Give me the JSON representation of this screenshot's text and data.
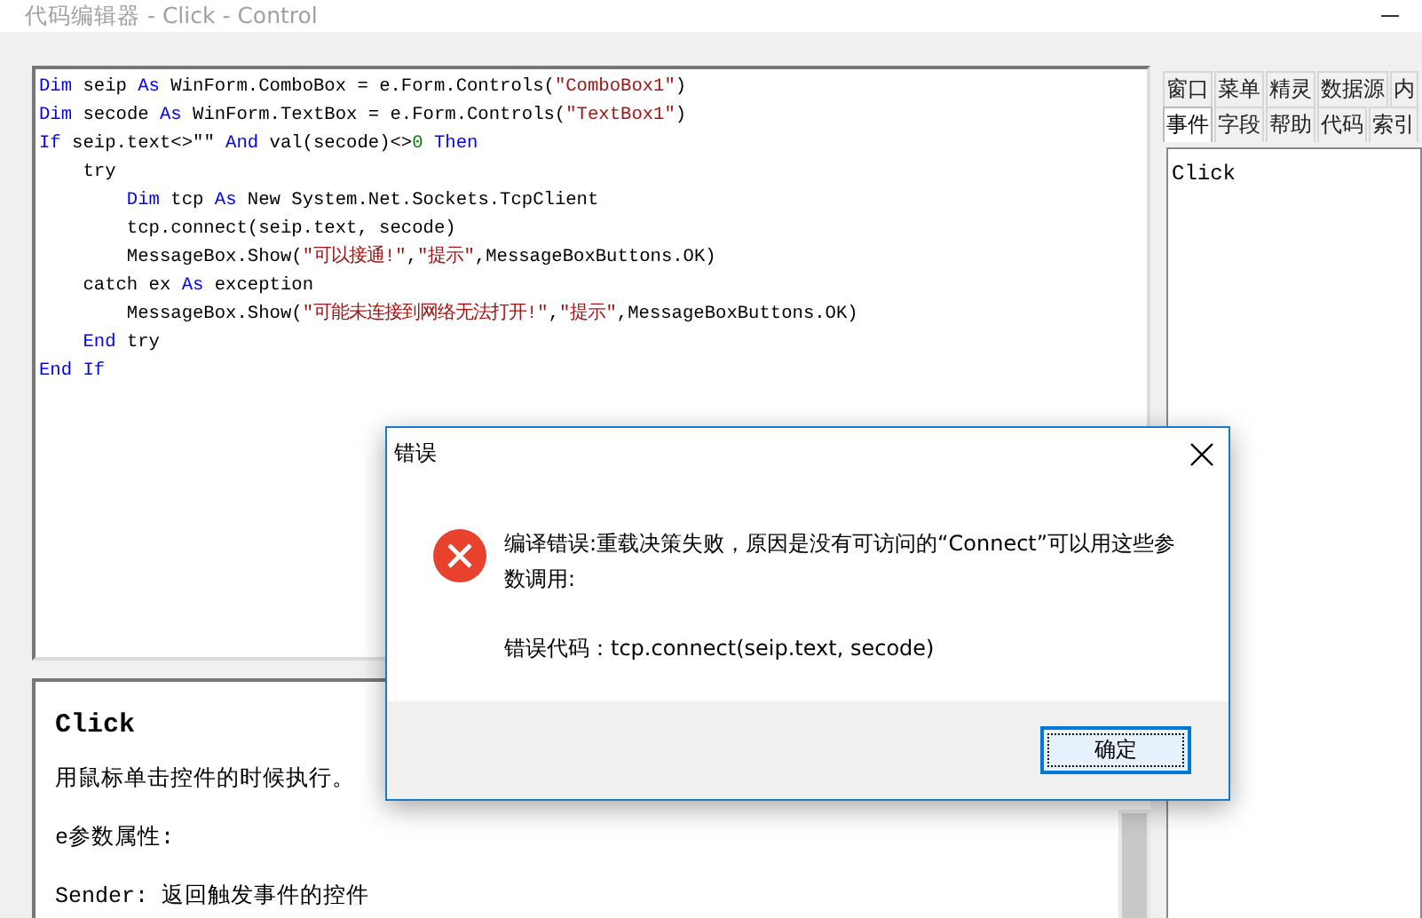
{
  "window": {
    "title": "代码编辑器 - Click - Control"
  },
  "code_editor": {
    "lines": [
      {
        "tokens": [
          {
            "text": "Dim",
            "kind": "keyword"
          },
          {
            "text": " seip ",
            "kind": "plain"
          },
          {
            "text": "As",
            "kind": "keyword"
          },
          {
            "text": " WinForm.ComboBox = e.Form.Controls(",
            "kind": "plain"
          },
          {
            "text": "\"ComboBox1\"",
            "kind": "string"
          },
          {
            "text": ")",
            "kind": "plain"
          }
        ]
      },
      {
        "tokens": [
          {
            "text": "Dim",
            "kind": "keyword"
          },
          {
            "text": " secode ",
            "kind": "plain"
          },
          {
            "text": "As",
            "kind": "keyword"
          },
          {
            "text": " WinForm.TextBox = e.Form.Controls(",
            "kind": "plain"
          },
          {
            "text": "\"TextBox1\"",
            "kind": "string"
          },
          {
            "text": ")",
            "kind": "plain"
          }
        ]
      },
      {
        "tokens": [
          {
            "text": "If",
            "kind": "keyword"
          },
          {
            "text": " seip.text<>\"\" ",
            "kind": "plain"
          },
          {
            "text": "And",
            "kind": "keyword"
          },
          {
            "text": " val(secode)<>",
            "kind": "plain"
          },
          {
            "text": "0",
            "kind": "number"
          },
          {
            "text": " Then",
            "kind": "keyword"
          }
        ]
      },
      {
        "tokens": [
          {
            "text": "    try",
            "kind": "plain"
          }
        ]
      },
      {
        "tokens": [
          {
            "text": "        Dim",
            "kind": "keyword"
          },
          {
            "text": " tcp ",
            "kind": "plain"
          },
          {
            "text": "As",
            "kind": "keyword"
          },
          {
            "text": " New System.Net.Sockets.TcpClient",
            "kind": "plain"
          }
        ]
      },
      {
        "tokens": [
          {
            "text": "        tcp.connect(seip.text, secode)",
            "kind": "plain"
          }
        ]
      },
      {
        "tokens": [
          {
            "text": "        MessageBox.Show(",
            "kind": "plain"
          },
          {
            "text": "\"可以接通!\"",
            "kind": "string"
          },
          {
            "text": ",",
            "kind": "plain"
          },
          {
            "text": "\"提示\"",
            "kind": "string"
          },
          {
            "text": ",MessageBoxButtons.OK)",
            "kind": "plain"
          }
        ]
      },
      {
        "tokens": [
          {
            "text": "    catch ex ",
            "kind": "plain"
          },
          {
            "text": "As",
            "kind": "keyword"
          },
          {
            "text": " exception",
            "kind": "plain"
          }
        ]
      },
      {
        "tokens": [
          {
            "text": "        MessageBox.Show(",
            "kind": "plain"
          },
          {
            "text": "\"可能未连接到网络无法打开!\"",
            "kind": "string"
          },
          {
            "text": ",",
            "kind": "plain"
          },
          {
            "text": "\"提示\"",
            "kind": "string"
          },
          {
            "text": ",MessageBoxButtons.OK)",
            "kind": "plain"
          }
        ]
      },
      {
        "tokens": [
          {
            "text": "    End",
            "kind": "keyword"
          },
          {
            "text": " try",
            "kind": "plain"
          }
        ]
      },
      {
        "tokens": [
          {
            "text": "End If",
            "kind": "keyword"
          }
        ]
      }
    ]
  },
  "help": {
    "title": "Click",
    "paragraphs": [
      "用鼠标单击控件的时候执行。",
      "e参数属性:",
      "Sender: 返回触发事件的控件"
    ]
  },
  "side_panel": {
    "tab_rows": [
      {
        "tabs": [
          {
            "label": "窗口",
            "selected": false
          },
          {
            "label": "菜单",
            "selected": false
          },
          {
            "label": "精灵",
            "selected": false
          },
          {
            "label": "数据源",
            "selected": false
          },
          {
            "label": "内",
            "selected": false
          }
        ]
      },
      {
        "tabs": [
          {
            "label": "事件",
            "selected": true
          },
          {
            "label": "字段",
            "selected": false
          },
          {
            "label": "帮助",
            "selected": false
          },
          {
            "label": "代码",
            "selected": false
          },
          {
            "label": "索引",
            "selected": false
          }
        ]
      }
    ],
    "list_items": [
      "Click"
    ]
  },
  "dialog": {
    "title": "错误",
    "message": "编译错误:重载决策失败，原因是没有可访问的“Connect”可以用这些参数调用:",
    "detail": "错误代码：tcp.connect(seip.text, secode)",
    "buttons": [
      {
        "label": "确定",
        "default": true
      }
    ]
  }
}
